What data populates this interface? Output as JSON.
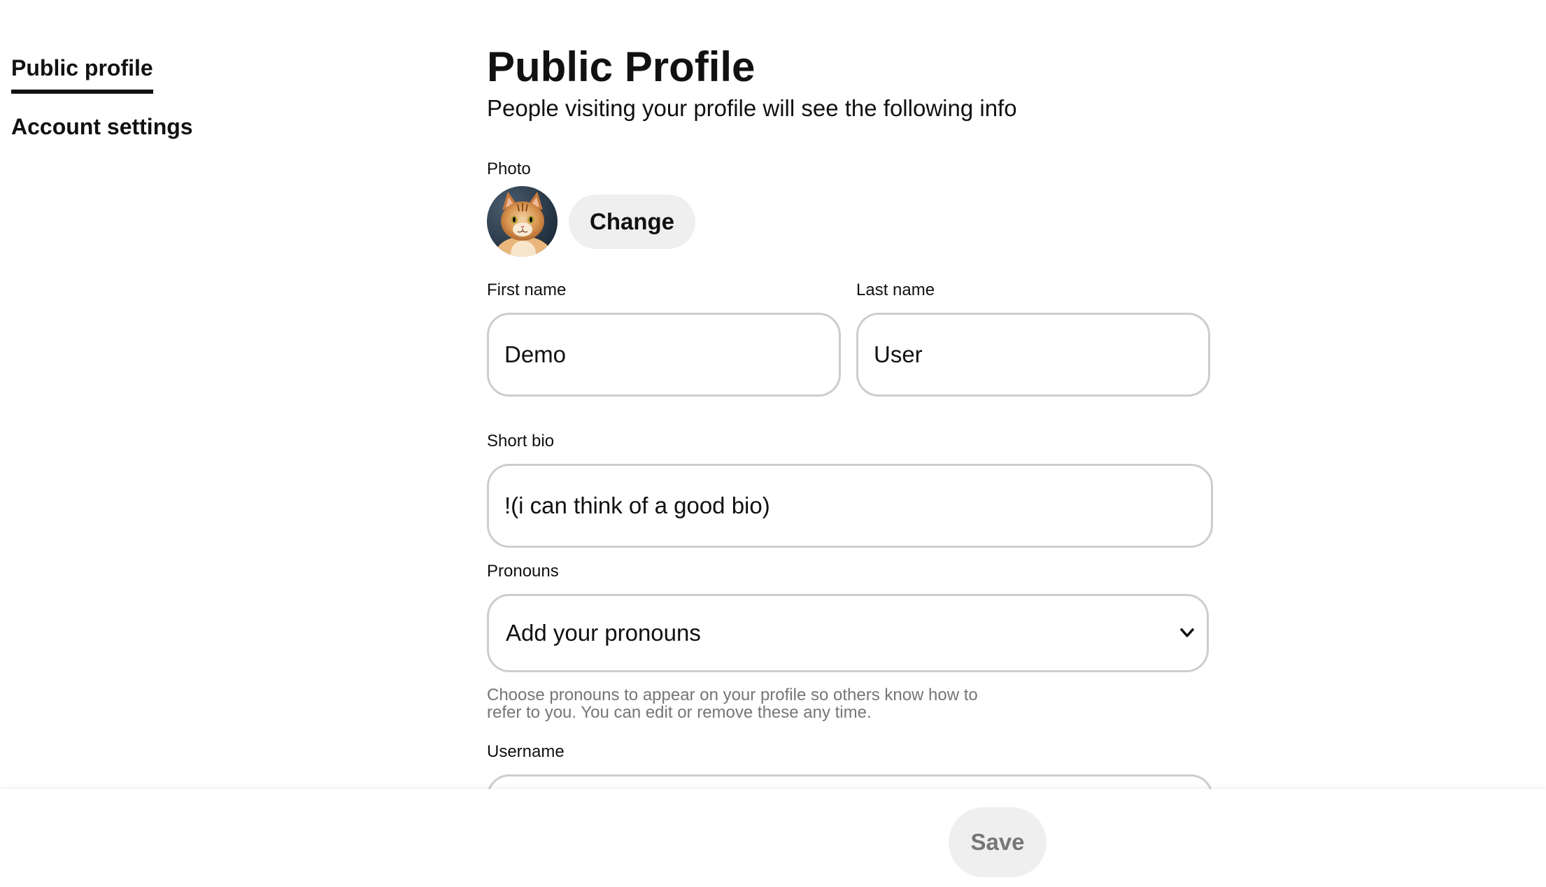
{
  "nav": {
    "items": [
      {
        "label": "Public profile",
        "active": true
      },
      {
        "label": "Account settings",
        "active": false
      }
    ]
  },
  "header": {
    "title": "Public Profile",
    "subtitle": "People visiting your profile will see the following info"
  },
  "photo": {
    "label": "Photo",
    "avatar_icon": "cat-avatar",
    "change_label": "Change"
  },
  "first_name": {
    "label": "First name",
    "value": "Demo"
  },
  "last_name": {
    "label": "Last name",
    "value": "User"
  },
  "bio": {
    "label": "Short bio",
    "value": "!(i can think of a good bio)"
  },
  "pronouns": {
    "label": "Pronouns",
    "selected": "Add your pronouns",
    "help": "Choose pronouns to appear on your profile so others know how to refer to you. You can edit or remove these any time."
  },
  "username": {
    "label": "Username"
  },
  "footer": {
    "save_label": "Save"
  },
  "colors": {
    "text": "#111111",
    "muted": "#767676",
    "border": "#cdcdcd",
    "button_bg": "#efefef"
  }
}
